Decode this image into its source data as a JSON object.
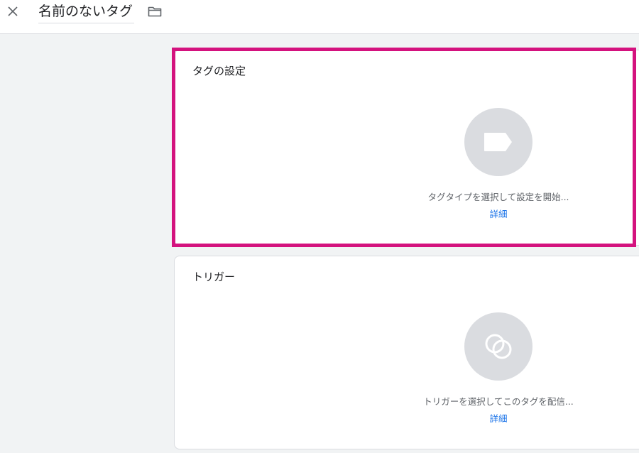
{
  "header": {
    "close_icon": "close-icon",
    "tag_name": "名前のないタグ",
    "folder_icon": "folder-icon"
  },
  "tag_config": {
    "title": "タグの設定",
    "icon": "tag-icon",
    "hint": "タグタイプを選択して設定を開始...",
    "link": "詳細"
  },
  "triggering": {
    "title": "トリガー",
    "icon": "trigger-icon",
    "hint": "トリガーを選択してこのタグを配信...",
    "link": "詳細"
  },
  "colors": {
    "highlight": "#d4127e",
    "link": "#1a73e8",
    "background": "#f1f3f4",
    "icon_circle": "#dadce0"
  }
}
